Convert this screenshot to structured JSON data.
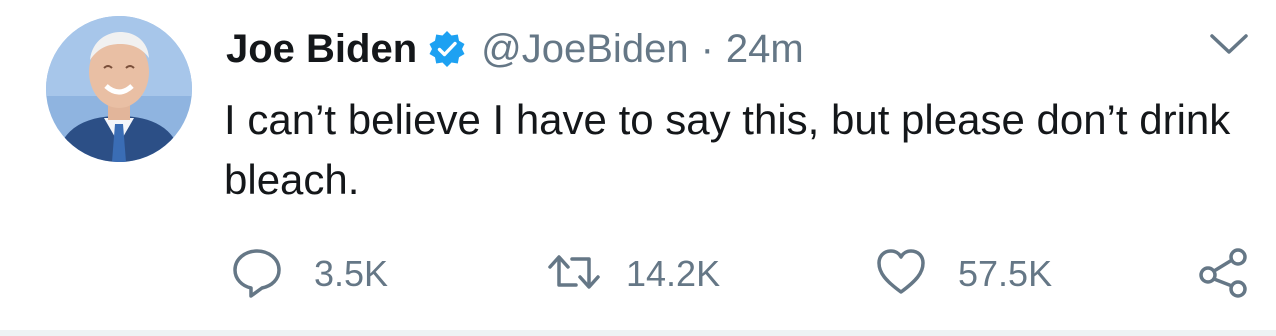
{
  "tweet": {
    "author_name": "Joe Biden",
    "handle": "@JoeBiden",
    "separator": "·",
    "timestamp": "24m",
    "verified": true,
    "text": "I can’t believe I have to say this, but please don’t drink bleach.",
    "replies": "3.5K",
    "retweets": "14.2K",
    "likes": "57.5K"
  },
  "icons": {
    "verified": "verified-badge-icon",
    "menu": "chevron-down-icon",
    "reply": "reply-icon",
    "retweet": "retweet-icon",
    "like": "heart-icon",
    "share": "share-icon"
  },
  "colors": {
    "verified_blue": "#1da1f2",
    "secondary_text": "#657786",
    "primary_text": "#14171a"
  }
}
